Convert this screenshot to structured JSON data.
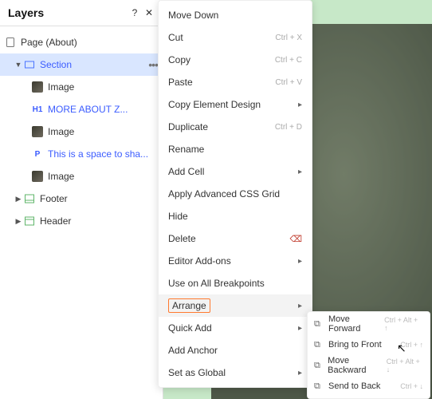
{
  "panel_title": "Layers",
  "tree": {
    "page": "Page (About)",
    "section": "Section",
    "img1": "Image",
    "tag_h1": "H1",
    "h1": "MORE ABOUT Z...",
    "img2": "Image",
    "tag_p": "P",
    "p": "This is a space to sha...",
    "img3": "Image",
    "footer": "Footer",
    "header": "Header"
  },
  "menu": {
    "move_down": "Move Down",
    "cut": "Cut",
    "cut_sc": "Ctrl + X",
    "copy": "Copy",
    "copy_sc": "Ctrl + C",
    "paste": "Paste",
    "paste_sc": "Ctrl + V",
    "copy_design": "Copy Element Design",
    "duplicate": "Duplicate",
    "dup_sc": "Ctrl + D",
    "rename": "Rename",
    "add_cell": "Add Cell",
    "apply_grid": "Apply Advanced CSS Grid",
    "hide": "Hide",
    "delete": "Delete",
    "addons": "Editor Add-ons",
    "breakpoints": "Use on All Breakpoints",
    "arrange": "Arrange",
    "quick_add": "Quick Add",
    "add_anchor": "Add Anchor",
    "set_global": "Set as Global"
  },
  "submenu": {
    "fwd": "Move Forward",
    "fwd_sc": "Ctrl + Alt + ↑",
    "front": "Bring to Front",
    "front_sc": "Ctrl + ↑",
    "bwd": "Move Backward",
    "bwd_sc": "Ctrl + Alt + ↓",
    "back": "Send to Back",
    "back_sc": "Ctrl + ↓"
  }
}
